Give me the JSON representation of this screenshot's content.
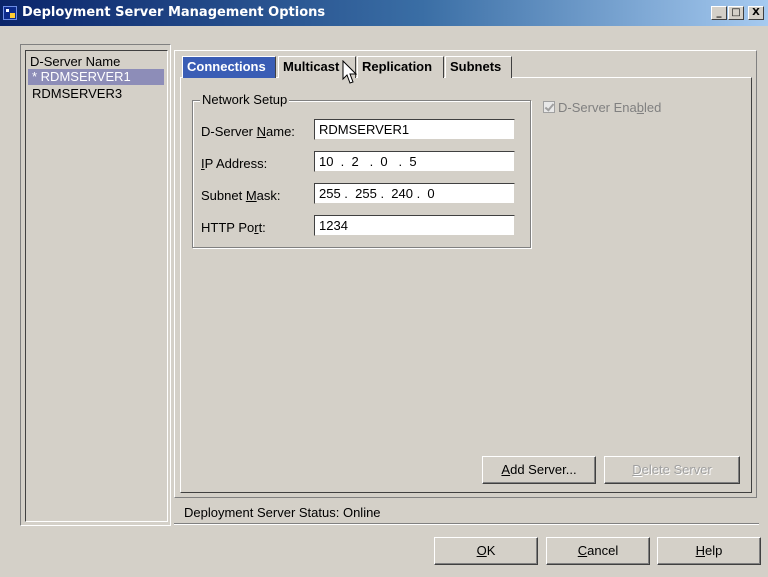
{
  "window": {
    "title": "Deployment Server Management Options",
    "controls": [
      "_",
      "□",
      "X"
    ]
  },
  "server_list": {
    "header": "D-Server Name",
    "items": [
      {
        "label": "* RDMSERVER1",
        "selected": true
      },
      {
        "label": "RDMSERVER3",
        "selected": false
      }
    ]
  },
  "tabs": [
    {
      "label": "Connections",
      "active": true
    },
    {
      "label": "Multicast",
      "active": false
    },
    {
      "label": "Replication",
      "active": false
    },
    {
      "label": "Subnets",
      "active": false
    }
  ],
  "network_setup": {
    "legend": "Network Setup",
    "fields": {
      "server_name": {
        "label": "D-Server Name:",
        "value": "RDMSERVER1"
      },
      "ip_address": {
        "label": "IP Address:",
        "value": "10  .  2   .  0   .  5"
      },
      "subnet_mask": {
        "label": "Subnet Mask:",
        "value": "255 .  255 .  240 .  0"
      },
      "http_port": {
        "label": "HTTP Port:",
        "value": "1234"
      }
    }
  },
  "d_server_enabled": {
    "label": "D-Server Enabled",
    "checked": true,
    "disabled": true
  },
  "buttons": {
    "add_server": "Add Server...",
    "delete_server": "Delete Server",
    "ok": "OK",
    "cancel": "Cancel",
    "help": "Help"
  },
  "status": {
    "text": "Deployment Server Status: Online"
  },
  "colors": {
    "titlebar": "#0a246a",
    "active_tab": "#3a5db5",
    "selected_item": "#8d8db8",
    "face": "#d4d0c8"
  },
  "icons": {
    "app": "server-app-icon",
    "cursor": "mouse-pointer-icon"
  }
}
